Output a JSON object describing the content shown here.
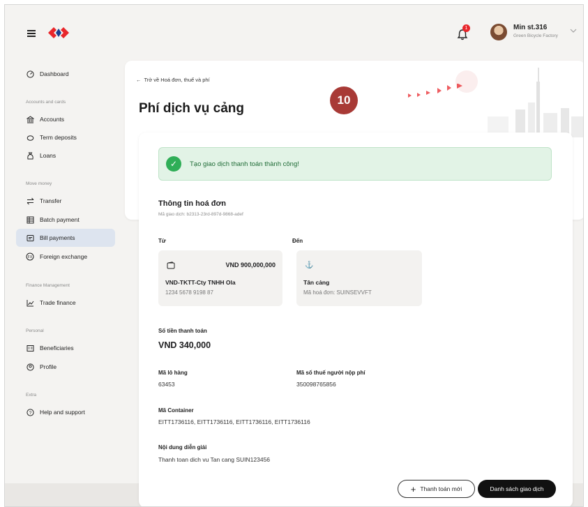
{
  "header": {
    "user_name": "Min st.316",
    "user_company": "Green Bicycle Factory",
    "notification_count": "1"
  },
  "sidebar": {
    "dashboard": "Dashboard",
    "section_accounts": "Accounts and cards",
    "accounts": "Accounts",
    "term_deposits": "Term deposits",
    "loans": "Loans",
    "section_move_money": "Move money",
    "transfer": "Transfer",
    "batch_payment": "Batch payment",
    "bill_payments": "Bill payments",
    "foreign_exchange": "Foreign exchange",
    "section_finance": "Finance Management",
    "trade_finance": "Trade finance",
    "section_personal": "Personal",
    "beneficiaries": "Beneficiaries",
    "profile": "Profile",
    "section_extra": "Extra",
    "help": "Help and support"
  },
  "page": {
    "back_link": "Trở về Hoá đơn, thuế và phí",
    "title": "Phí dịch vụ cảng",
    "step_badge": "10"
  },
  "content": {
    "success_message": "Tạo giao dịch thanh toán thành công!",
    "section_title": "Thông tin hoá đơn",
    "transaction_id": "Mã giao dịch: b2313-23rd-897d-9868-adef",
    "from_label": "Từ",
    "to_label": "Đến",
    "from_amount": "VND 900,000,000",
    "from_name": "VND-TKTT-Cty TNHH Ola",
    "from_account": "1234 5678 9198 87",
    "to_name": "Tân cảng",
    "to_sub": "Mã hoá đơn: SUINSEVVFT",
    "amount_label": "Số tiền thanh toán",
    "amount_value": "VND 340,000",
    "lot_label": "Mã lô hàng",
    "lot_value": "63453",
    "tax_label": "Mã số thuế người nộp phí",
    "tax_value": "350098765856",
    "container_label": "Mã Container",
    "container_value": "EITT1736116, EITT1736116, EITT1736116, EITT1736116",
    "desc_label": "Nội dung diễn giải",
    "desc_value": "Thanh toan dich vu Tan cang SUIN123456",
    "new_payment_button": "Thanh toán mới",
    "transactions_button": "Danh sách giao dịch"
  },
  "colors": {
    "brand_red": "#e8262b",
    "success_green": "#2fae57",
    "active_nav": "#dde4ef"
  }
}
